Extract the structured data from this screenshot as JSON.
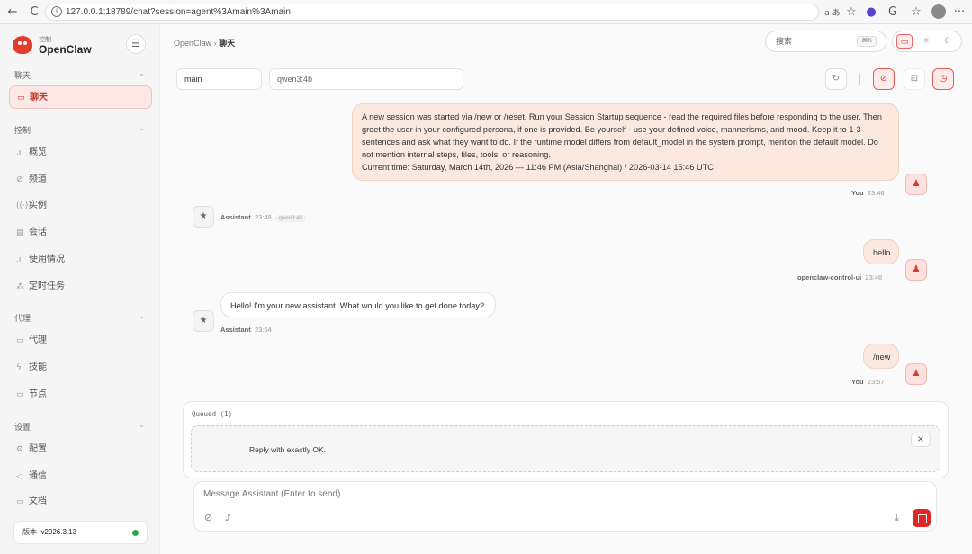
{
  "browser": {
    "back": "←",
    "reload": "C",
    "info": "i",
    "url": "127.0.0.1:18789/chat?session=agent%3Amain%3Amain",
    "icons": {
      "translate": "a あ",
      "star": "☆",
      "profile": "●",
      "refresh": "G",
      "favorites": "☆",
      "menu": "···"
    }
  },
  "sidebar": {
    "brand_sub": "控制",
    "brand_name": "OpenClaw",
    "menu_icon": "☰",
    "sections": [
      {
        "title": "聊天",
        "items": [
          {
            "label": "聊天",
            "icon": "▭",
            "active": true
          }
        ]
      },
      {
        "title": "控制",
        "items": [
          {
            "label": "概览",
            "icon": ".ıl"
          },
          {
            "label": "频道",
            "icon": "⊘"
          },
          {
            "label": "实例",
            "icon": "((·))"
          },
          {
            "label": "会话",
            "icon": "▤"
          },
          {
            "label": "使用情况",
            "icon": ".ıl"
          },
          {
            "label": "定时任务",
            "icon": "⁂"
          }
        ]
      },
      {
        "title": "代理",
        "items": [
          {
            "label": "代理",
            "icon": "▭"
          },
          {
            "label": "技能",
            "icon": "ϟ"
          },
          {
            "label": "节点",
            "icon": "▭"
          }
        ]
      },
      {
        "title": "设置",
        "items": [
          {
            "label": "配置",
            "icon": "⚙"
          },
          {
            "label": "通信",
            "icon": "◁"
          }
        ]
      }
    ],
    "docs": {
      "label": "文档",
      "icon": "▭"
    },
    "version_label": "版本",
    "version": "v2026.3.13"
  },
  "header": {
    "breadcrumb_root": "OpenClaw",
    "breadcrumb_sep": "›",
    "breadcrumb_current": "聊天",
    "search_placeholder": "搜索",
    "search_kbd": "⌘K",
    "theme_icons": [
      "▭",
      "☼",
      "☾"
    ]
  },
  "toolbar": {
    "session": "main",
    "model": "qwen3:4b",
    "buttons": [
      "↻",
      "⊘",
      "⊡",
      "◷"
    ]
  },
  "messages": [
    {
      "role": "user",
      "text": "A new session was started via /new or /reset. Run your Session Startup sequence - read the required files before responding to the user. Then greet the user in your configured persona, if one is provided. Be yourself - use your defined voice, mannerisms, and mood. Keep it to 1-3 sentences and ask what they want to do. If the runtime model differs from default_model in the system prompt, mention the default model. Do not mention internal steps, files, tools, or reasoning.",
      "text2": "Current time: Saturday, March 14th, 2026 — 11:46 PM (Asia/Shanghai) / 2026-03-14 15:46 UTC",
      "sender": "You",
      "time": "23:46"
    },
    {
      "role": "assistant",
      "text": "",
      "sender": "Assistant",
      "time": "23:48",
      "model": "qwen3:4b"
    },
    {
      "role": "user",
      "text": "hello",
      "sender": "openclaw-control-ui",
      "time": "23:48"
    },
    {
      "role": "assistant",
      "text": "Hello! I'm your new assistant. What would you like to get done today?",
      "sender": "Assistant",
      "time": "23:54"
    },
    {
      "role": "user",
      "text": "/new",
      "sender": "You",
      "time": "23:57"
    }
  ],
  "avatar_icons": {
    "user": "♟",
    "assistant": "★"
  },
  "queue": {
    "title": "Queued (1)",
    "item": "Reply with exactly OK.",
    "remove": "×"
  },
  "composer": {
    "placeholder": "Message Assistant (Enter to send)",
    "attach": "⊘",
    "mic": "♪",
    "download": "⤓"
  }
}
